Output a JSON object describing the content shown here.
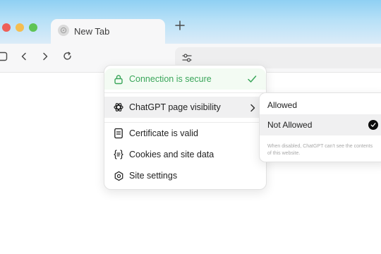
{
  "tab": {
    "title": "New Tab"
  },
  "popover": {
    "secure_label": "Connection is secure",
    "visibility_label": "ChatGPT page visibility",
    "items": [
      {
        "label": "Certificate is valid",
        "icon": "certificate-icon"
      },
      {
        "label": "Cookies and site data",
        "icon": "cookies-icon"
      },
      {
        "label": "Site settings",
        "icon": "gear-icon"
      }
    ]
  },
  "submenu": {
    "options": [
      {
        "label": "Allowed",
        "selected": false
      },
      {
        "label": "Not Allowed",
        "selected": true
      }
    ],
    "note": "When disabled, ChatGPT can't see the contents of this website."
  },
  "colors": {
    "secure_green": "#3aa65a",
    "accent": "#0d0d0d"
  }
}
